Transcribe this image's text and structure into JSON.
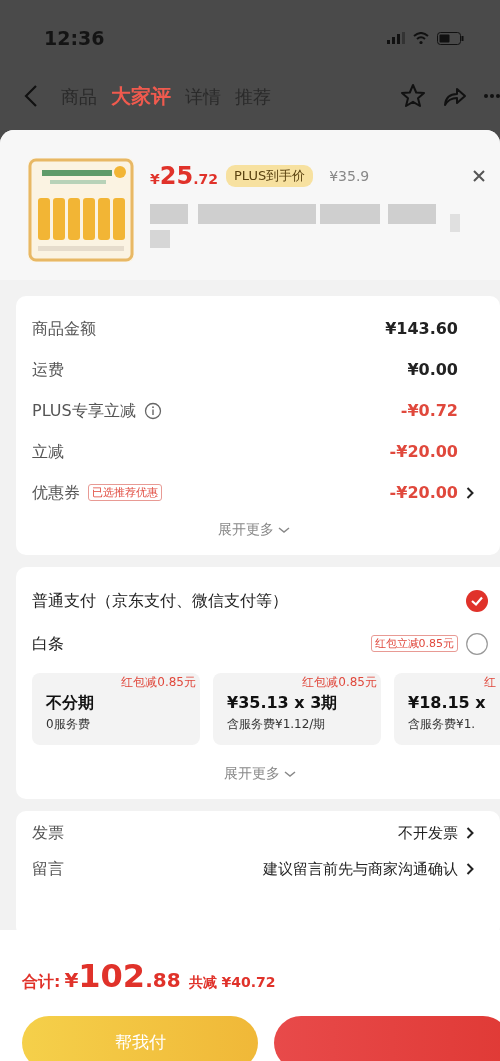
{
  "status_bar": {
    "time": "12:36"
  },
  "nav": {
    "tabs": [
      {
        "label": "商品",
        "selected": false
      },
      {
        "label": "大家评",
        "selected": true
      },
      {
        "label": "详情",
        "selected": false
      },
      {
        "label": "推荐",
        "selected": false
      }
    ]
  },
  "product": {
    "kind": "picture",
    "price": {
      "currency": "¥",
      "integer": "25",
      "decimal": ".72"
    },
    "plus_badge": "PLUS到手价",
    "original_price": "¥35.9"
  },
  "summary": {
    "rows": [
      {
        "label": "商品金额",
        "value": "¥143.60",
        "kind": "plain",
        "info": false,
        "chevron": false
      },
      {
        "label": "运费",
        "value": "¥0.00",
        "kind": "plain",
        "info": false,
        "chevron": false
      },
      {
        "label": "PLUS专享立减",
        "value": "-¥0.72",
        "kind": "discount",
        "info": true,
        "chevron": false
      },
      {
        "label": "立减",
        "value": "-¥20.00",
        "kind": "discount",
        "info": false,
        "chevron": false
      },
      {
        "label": "优惠券",
        "tag": "已选推荐优惠",
        "value": "-¥20.00",
        "kind": "discount",
        "info": false,
        "chevron": true
      }
    ],
    "expand": "展开更多"
  },
  "payment": {
    "options": [
      {
        "label": "普通支付（京东支付、微信支付等）",
        "selected": true
      },
      {
        "label": "白条",
        "tag": "红包立减0.85元",
        "selected": false
      }
    ],
    "installments": [
      {
        "tag": "红包减0.85元",
        "title": "不分期",
        "subtitle": "0服务费"
      },
      {
        "tag": "红包减0.85元",
        "title": "¥35.13 x 3期",
        "subtitle": "含服务费¥1.12/期"
      },
      {
        "tag": "红",
        "title": "¥18.15 x",
        "subtitle": "含服务费¥1."
      }
    ],
    "expand": "展开更多"
  },
  "other_rows": [
    {
      "label": "发票",
      "value": "不开发票",
      "chevron": true
    },
    {
      "label": "留言",
      "value": "建议留言前先与商家沟通确认",
      "chevron": true
    }
  ],
  "footer": {
    "total_label": "合计:",
    "total": {
      "currency": "¥",
      "integer": "102",
      "decimal": ".88"
    },
    "savings": "共减 ¥40.72",
    "buttons": [
      {
        "label": "帮我付",
        "kind": "secondary"
      },
      {
        "kind": "primary"
      }
    ]
  }
}
